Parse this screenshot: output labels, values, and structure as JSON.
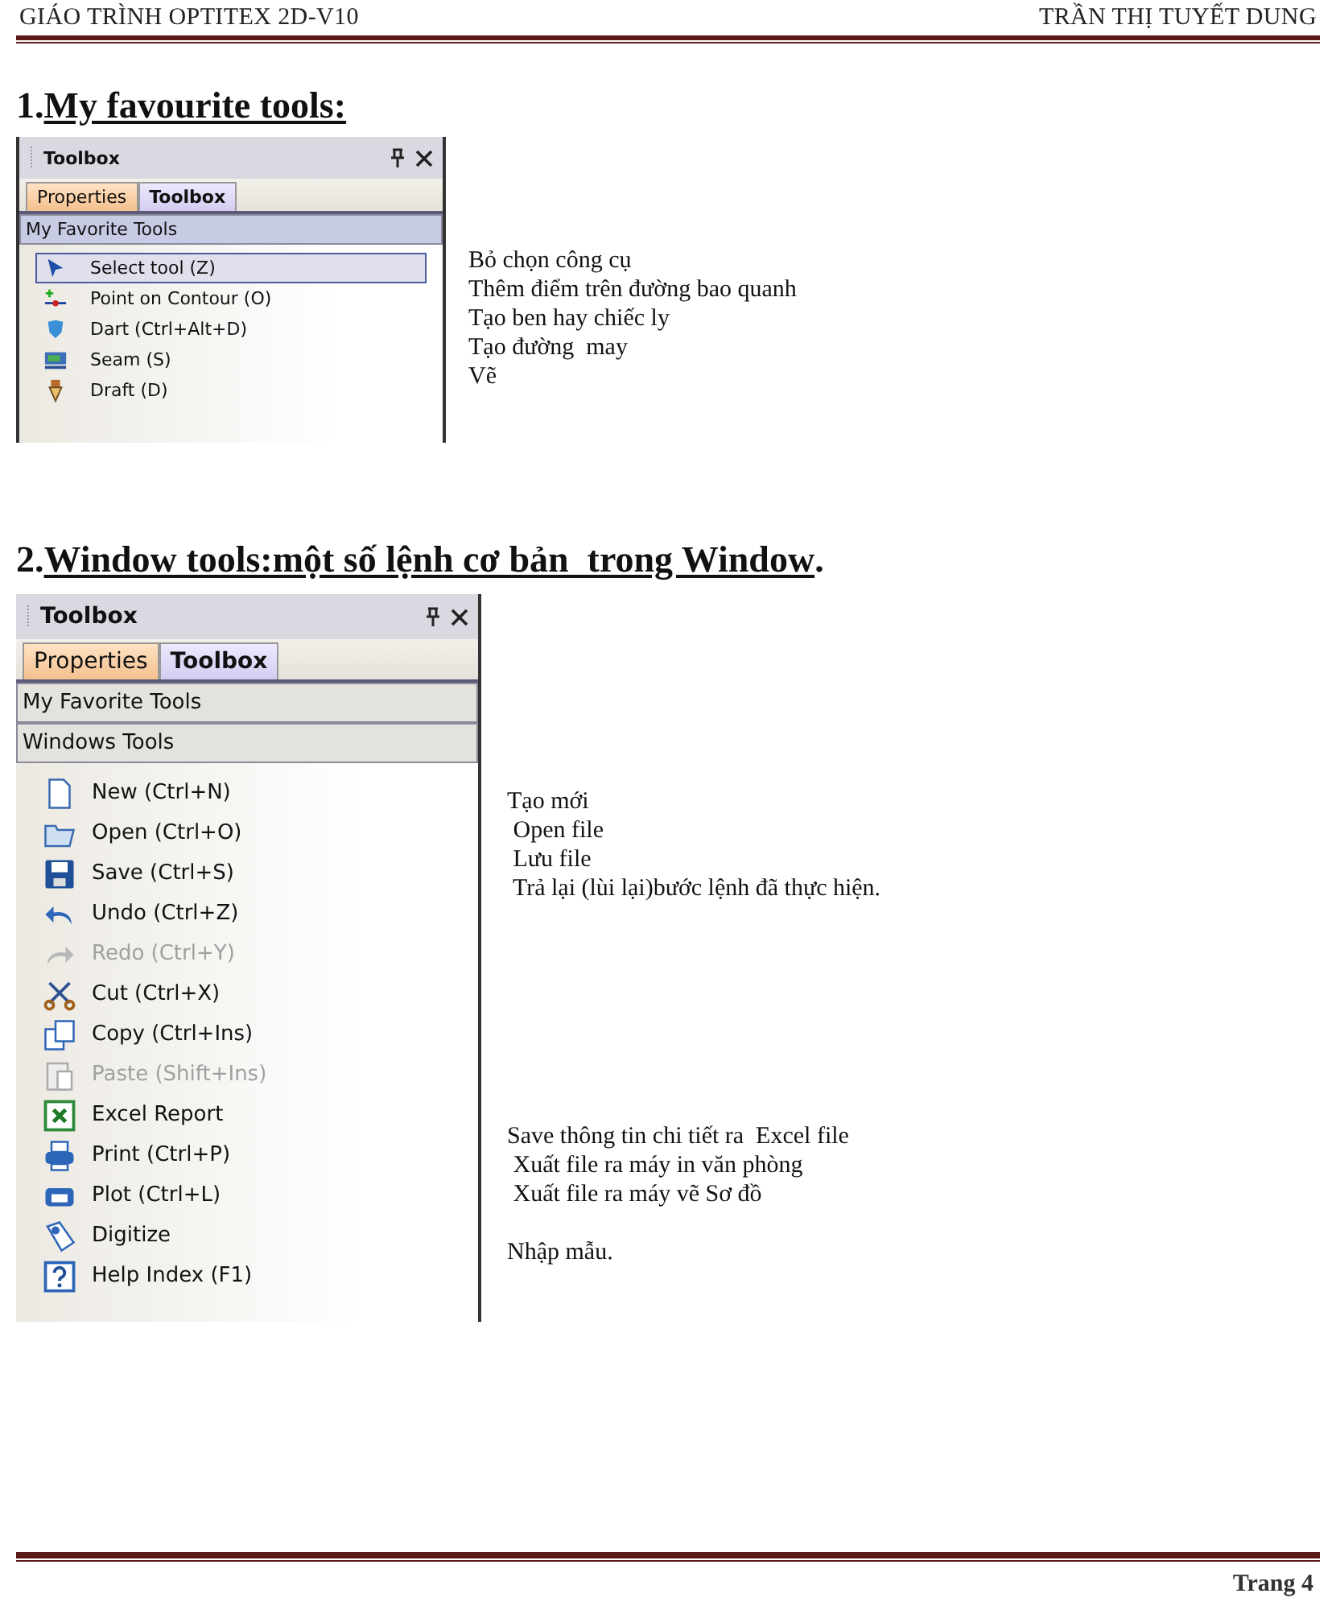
{
  "header": {
    "left": "GIÁO TRÌNH OPTITEX 2D-V10",
    "right": "TRẦN THỊ TUYẾT DUNG"
  },
  "sections": [
    {
      "number": "1.",
      "title": "My favourite tools:",
      "kind": "compact",
      "panel": {
        "title": "Toolbox",
        "tabs": [
          {
            "label": "Properties",
            "selected": false
          },
          {
            "label": "Toolbox",
            "selected": true
          }
        ],
        "groups": [
          {
            "label": "My Favorite Tools"
          }
        ],
        "items": [
          {
            "label": "Select tool (Z)",
            "selected": true,
            "disabled": false
          },
          {
            "label": "Point on Contour (O)",
            "selected": false,
            "disabled": false
          },
          {
            "label": "Dart (Ctrl+Alt+D)",
            "selected": false,
            "disabled": false
          },
          {
            "label": "Seam (S)",
            "selected": false,
            "disabled": false
          },
          {
            "label": "Draft (D)",
            "selected": false,
            "disabled": false
          }
        ]
      },
      "notes": [
        {
          "lines": [
            "Bỏ chọn công cụ",
            "Thêm điểm trên đường bao quanh",
            "Tạo ben hay chiếc ly",
            "Tạo đường  may",
            "Vẽ"
          ]
        }
      ]
    },
    {
      "number": "2.",
      "title": "Window tools:một số lệnh cơ bản  trong Window",
      "tail": ".",
      "kind": "full",
      "panel": {
        "title": "Toolbox",
        "tabs": [
          {
            "label": "Properties",
            "selected": false
          },
          {
            "label": "Toolbox",
            "selected": true
          }
        ],
        "groups": [
          {
            "label": "My Favorite Tools"
          },
          {
            "label": "Windows Tools"
          }
        ],
        "items": [
          {
            "label": "New (Ctrl+N)",
            "selected": false,
            "disabled": false
          },
          {
            "label": "Open (Ctrl+O)",
            "selected": false,
            "disabled": false
          },
          {
            "label": "Save (Ctrl+S)",
            "selected": false,
            "disabled": false
          },
          {
            "label": "Undo (Ctrl+Z)",
            "selected": false,
            "disabled": false
          },
          {
            "label": "Redo (Ctrl+Y)",
            "selected": false,
            "disabled": true
          },
          {
            "label": "Cut (Ctrl+X)",
            "selected": false,
            "disabled": false
          },
          {
            "label": "Copy (Ctrl+Ins)",
            "selected": false,
            "disabled": false
          },
          {
            "label": "Paste (Shift+Ins)",
            "selected": false,
            "disabled": true
          },
          {
            "label": "Excel Report",
            "selected": false,
            "disabled": false
          },
          {
            "label": "Print (Ctrl+P)",
            "selected": false,
            "disabled": false
          },
          {
            "label": "Plot (Ctrl+L)",
            "selected": false,
            "disabled": false
          },
          {
            "label": "Digitize",
            "selected": false,
            "disabled": false
          },
          {
            "label": "Help Index (F1)",
            "selected": false,
            "disabled": false
          }
        ]
      },
      "notes": [
        {
          "lines": [
            "Tạo mới",
            " Open file",
            " Lưu file",
            " Trả lại (lùi lại)bước lệnh đã thực hiện."
          ]
        },
        {
          "lines": [
            "Save thông tin chi tiết ra  Excel file",
            " Xuất file ra máy in văn phòng",
            " Xuất file ra máy vẽ Sơ đồ"
          ]
        },
        {
          "lines": [
            "Nhập mẫu."
          ]
        }
      ]
    }
  ],
  "footer": {
    "page": "Trang 4"
  }
}
